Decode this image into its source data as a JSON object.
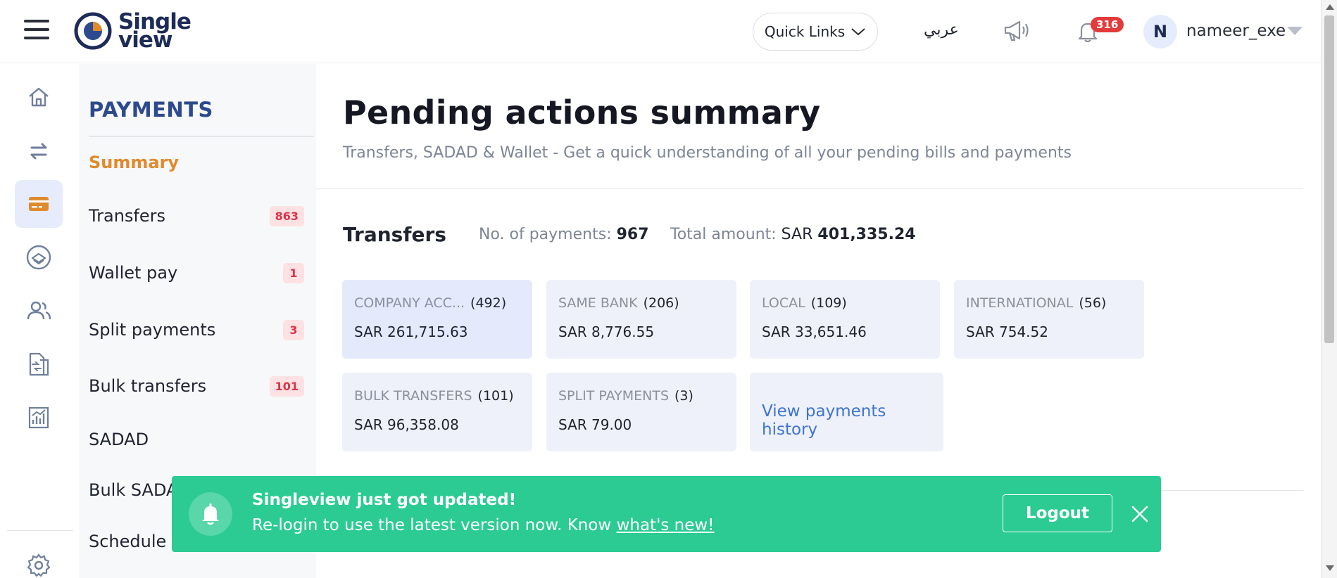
{
  "header": {
    "brand_line1": "Single",
    "brand_line2": "view",
    "quick_links_label": "Quick Links",
    "language_label": "عربي",
    "notification_count": "316",
    "avatar_initial": "N",
    "username": "nameer_exe"
  },
  "rail": {
    "items": [
      {
        "icon": "home-icon"
      },
      {
        "icon": "transfer-arrows-icon"
      },
      {
        "icon": "card-icon",
        "active": true
      },
      {
        "icon": "bill-icon"
      },
      {
        "icon": "users-icon"
      },
      {
        "icon": "document-transfer-icon"
      },
      {
        "icon": "chart-icon"
      },
      {
        "icon": "gear-icon"
      }
    ]
  },
  "subnav": {
    "title": "PAYMENTS",
    "items": [
      {
        "label": "Summary",
        "active": true
      },
      {
        "label": "Transfers",
        "count": "863"
      },
      {
        "label": "Wallet pay",
        "count": "1"
      },
      {
        "label": "Split payments",
        "count": "3"
      },
      {
        "label": "Bulk transfers",
        "count": "101"
      },
      {
        "label": "SADAD"
      },
      {
        "label": "Bulk SADAD"
      },
      {
        "label": "Schedule p"
      }
    ]
  },
  "main": {
    "title": "Pending actions summary",
    "subtitle": "Transfers, SADAD & Wallet - Get a quick understanding of all your pending bills and payments",
    "section_title": "Transfers",
    "payments_label": "No. of payments:",
    "payments_value": "967",
    "total_label": "Total amount:",
    "total_currency": "SAR",
    "total_value": "401,335.24",
    "cards": [
      {
        "category": "COMPANY ACC...",
        "count": "(492)",
        "amount": "SAR 261,715.63"
      },
      {
        "category": "SAME BANK",
        "count": "(206)",
        "amount": "SAR 8,776.55"
      },
      {
        "category": "LOCAL",
        "count": "(109)",
        "amount": "SAR 33,651.46"
      },
      {
        "category": "INTERNATIONAL",
        "count": "(56)",
        "amount": "SAR 754.52"
      },
      {
        "category": "BULK TRANSFERS",
        "count": "(101)",
        "amount": "SAR 96,358.08"
      },
      {
        "category": "SPLIT PAYMENTS",
        "count": "(3)",
        "amount": "SAR 79.00"
      }
    ],
    "history_link": "View payments history"
  },
  "toast": {
    "title": "Singleview just got updated!",
    "message": "Re-login to use the latest version now. Know ",
    "link": "what's new!",
    "button": "Logout"
  },
  "colors": {
    "brand_navy": "#1d2b57",
    "accent_orange": "#e08a2e",
    "toast_green": "#2bcb93",
    "badge_red": "#e23b3b",
    "link_blue": "#3d74cf"
  }
}
